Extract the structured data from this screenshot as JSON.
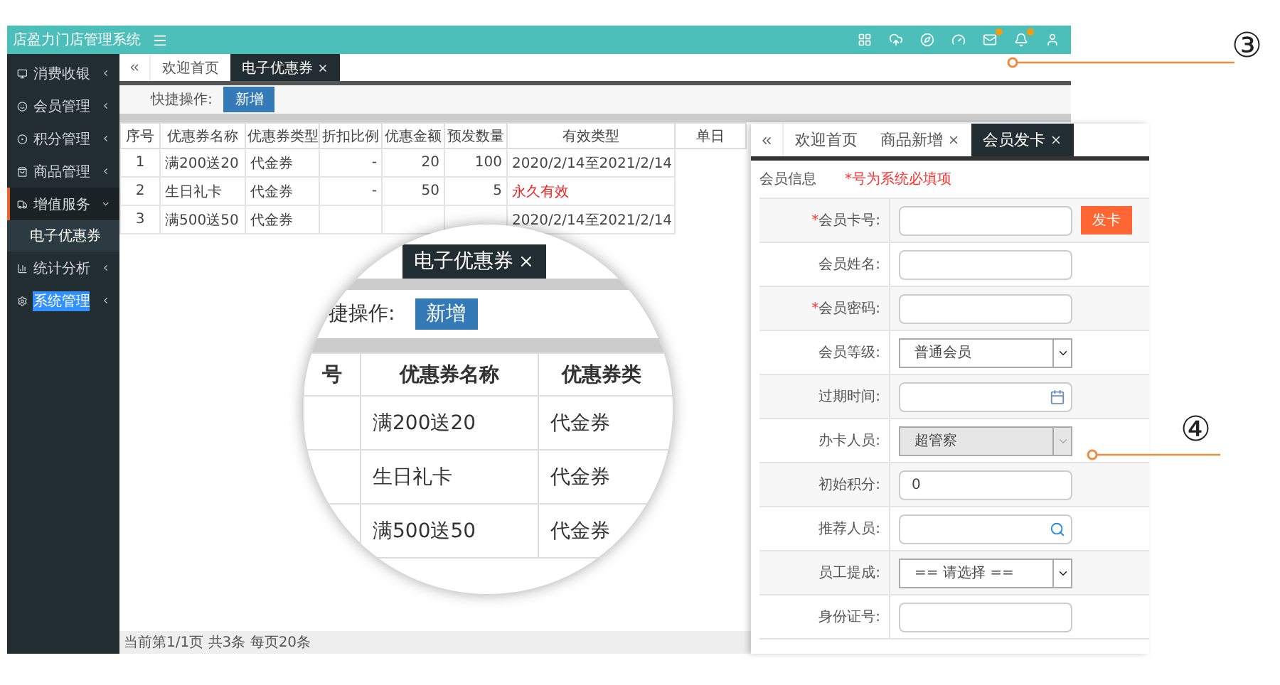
{
  "header": {
    "title": "店盈力门店管理系统",
    "icons": [
      {
        "kind": "grid",
        "badge": false
      },
      {
        "kind": "cloud",
        "badge": false
      },
      {
        "kind": "compass",
        "badge": false
      },
      {
        "kind": "gauge",
        "badge": false
      },
      {
        "kind": "mail",
        "badge": true
      },
      {
        "kind": "bell",
        "badge": true
      },
      {
        "kind": "user",
        "badge": false
      }
    ]
  },
  "sidebar": {
    "items": [
      {
        "label": "消费收银",
        "kind": "monitor",
        "expanded": false,
        "highlighted": false
      },
      {
        "label": "会员管理",
        "kind": "members",
        "expanded": false,
        "highlighted": false
      },
      {
        "label": "积分管理",
        "kind": "points",
        "expanded": false,
        "highlighted": false
      },
      {
        "label": "商品管理",
        "kind": "goods",
        "expanded": false,
        "highlighted": false
      },
      {
        "label": "增值服务",
        "kind": "service",
        "expanded": true,
        "highlighted": false,
        "children": [
          {
            "label": "电子优惠券",
            "selected": true
          }
        ]
      },
      {
        "label": "统计分析",
        "kind": "stats",
        "expanded": false,
        "highlighted": false
      },
      {
        "label": "系统管理",
        "kind": "settings",
        "expanded": false,
        "highlighted": true
      }
    ]
  },
  "tabs": [
    {
      "label": "欢迎首页",
      "selected": false,
      "closable": false
    },
    {
      "label": "电子优惠券",
      "selected": true,
      "closable": true
    }
  ],
  "quick_actions": {
    "label": "快捷操作:",
    "button": "新增"
  },
  "table": {
    "columns": [
      "序号",
      "优惠券名称",
      "优惠券类型",
      "折扣比例",
      "优惠金额",
      "预发数量",
      "有效类型",
      "单日"
    ],
    "rows": [
      {
        "cells": [
          "1",
          "满200送20",
          "代金券",
          "-",
          "20",
          "100",
          "2020/2/14至2021/2/14"
        ],
        "permanent": false
      },
      {
        "cells": [
          "2",
          "生日礼卡",
          "代金券",
          "-",
          "50",
          "5",
          "永久有效"
        ],
        "permanent": true
      },
      {
        "cells": [
          "3",
          "满500送50",
          "代金券",
          null,
          null,
          null,
          "2020/2/14至2021/2/14"
        ],
        "permanent": false
      }
    ]
  },
  "status_bar": "当前第1/1页 共3条 每页20条",
  "magnifier": {
    "tab": "电子优惠券",
    "quick_label": "捷操作:",
    "button": "新增",
    "columns": [
      "号",
      "优惠券名称",
      "优惠券类"
    ],
    "rows": [
      [
        "",
        "满200送20",
        "代金券"
      ],
      [
        "",
        "生日礼卡",
        "代金券"
      ],
      [
        "",
        "满500送50",
        "代金券"
      ]
    ]
  },
  "card_panel": {
    "tabs": [
      {
        "label": "欢迎首页",
        "selected": false,
        "closable": false
      },
      {
        "label": "商品新增",
        "selected": false,
        "closable": true
      },
      {
        "label": "会员发卡",
        "selected": true,
        "closable": true
      }
    ],
    "section": "会员信息",
    "note": "*号为系统必填项",
    "fields": [
      {
        "label": "会员卡号:",
        "kind": "text",
        "required_mark": "*",
        "disabled": false,
        "button": "发卡"
      },
      {
        "label": "会员姓名:",
        "kind": "text",
        "disabled": false
      },
      {
        "label": "会员密码:",
        "kind": "text",
        "required_mark": "*",
        "disabled": false
      },
      {
        "label": "会员等级:",
        "kind": "select",
        "disabled": false,
        "value": "普通会员"
      },
      {
        "label": "过期时间:",
        "kind": "date",
        "disabled": false
      },
      {
        "label": "办卡人员:",
        "kind": "select",
        "disabled": true,
        "value": "超管察"
      },
      {
        "label": "初始积分:",
        "kind": "text",
        "disabled": false,
        "value": "0"
      },
      {
        "label": "推荐人员:",
        "kind": "search",
        "disabled": false
      },
      {
        "label": "员工提成:",
        "kind": "select",
        "disabled": false,
        "value": "== 请选择 =="
      },
      {
        "label": "身份证号:",
        "kind": "text",
        "disabled": false
      }
    ]
  },
  "callouts": [
    {
      "label": "③"
    },
    {
      "label": "④"
    }
  ]
}
